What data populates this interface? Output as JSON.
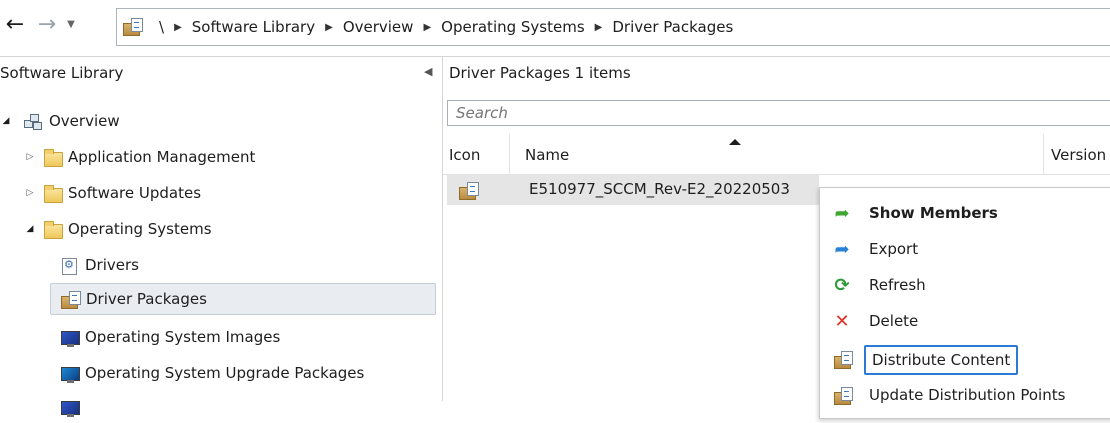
{
  "breadcrumb": {
    "root": "\\",
    "items": [
      "Software Library",
      "Overview",
      "Operating Systems",
      "Driver Packages"
    ]
  },
  "left_pane": {
    "title": "Software Library",
    "tree": [
      {
        "label": "Overview",
        "icon": "overview-icon",
        "expanded": true
      },
      {
        "label": "Application Management",
        "icon": "folder-icon",
        "expanded": false
      },
      {
        "label": "Software Updates",
        "icon": "folder-icon",
        "expanded": false
      },
      {
        "label": "Operating Systems",
        "icon": "folder-icon",
        "expanded": true
      },
      {
        "label": "Drivers",
        "icon": "driver-icon"
      },
      {
        "label": "Driver Packages",
        "icon": "driver-package-icon",
        "selected": true
      },
      {
        "label": "Operating System Images",
        "icon": "os-image-icon"
      },
      {
        "label": "Operating System Upgrade Packages",
        "icon": "os-upgrade-package-icon"
      }
    ]
  },
  "list": {
    "title": "Driver Packages 1 items",
    "search_placeholder": "Search",
    "columns": [
      "Icon",
      "Name",
      "Version"
    ],
    "rows": [
      {
        "icon": "driver-package-icon",
        "name": "E510977_SCCM_Rev-E2_20220503"
      }
    ]
  },
  "context_menu": {
    "items": [
      {
        "label": "Show Members",
        "icon": "show-members-icon",
        "bold": true
      },
      {
        "label": "Export",
        "icon": "export-icon"
      },
      {
        "label": "Refresh",
        "icon": "refresh-icon"
      },
      {
        "label": "Delete",
        "icon": "delete-icon"
      },
      {
        "label": "Distribute Content",
        "icon": "distribute-content-icon",
        "focused": true
      },
      {
        "label": "Update Distribution Points",
        "icon": "update-distribution-points-icon"
      }
    ]
  },
  "colors": {
    "accent_focus": "#2b7bd4",
    "selection_bg": "#e9edf2",
    "row_bg": "#e5e5e5"
  }
}
